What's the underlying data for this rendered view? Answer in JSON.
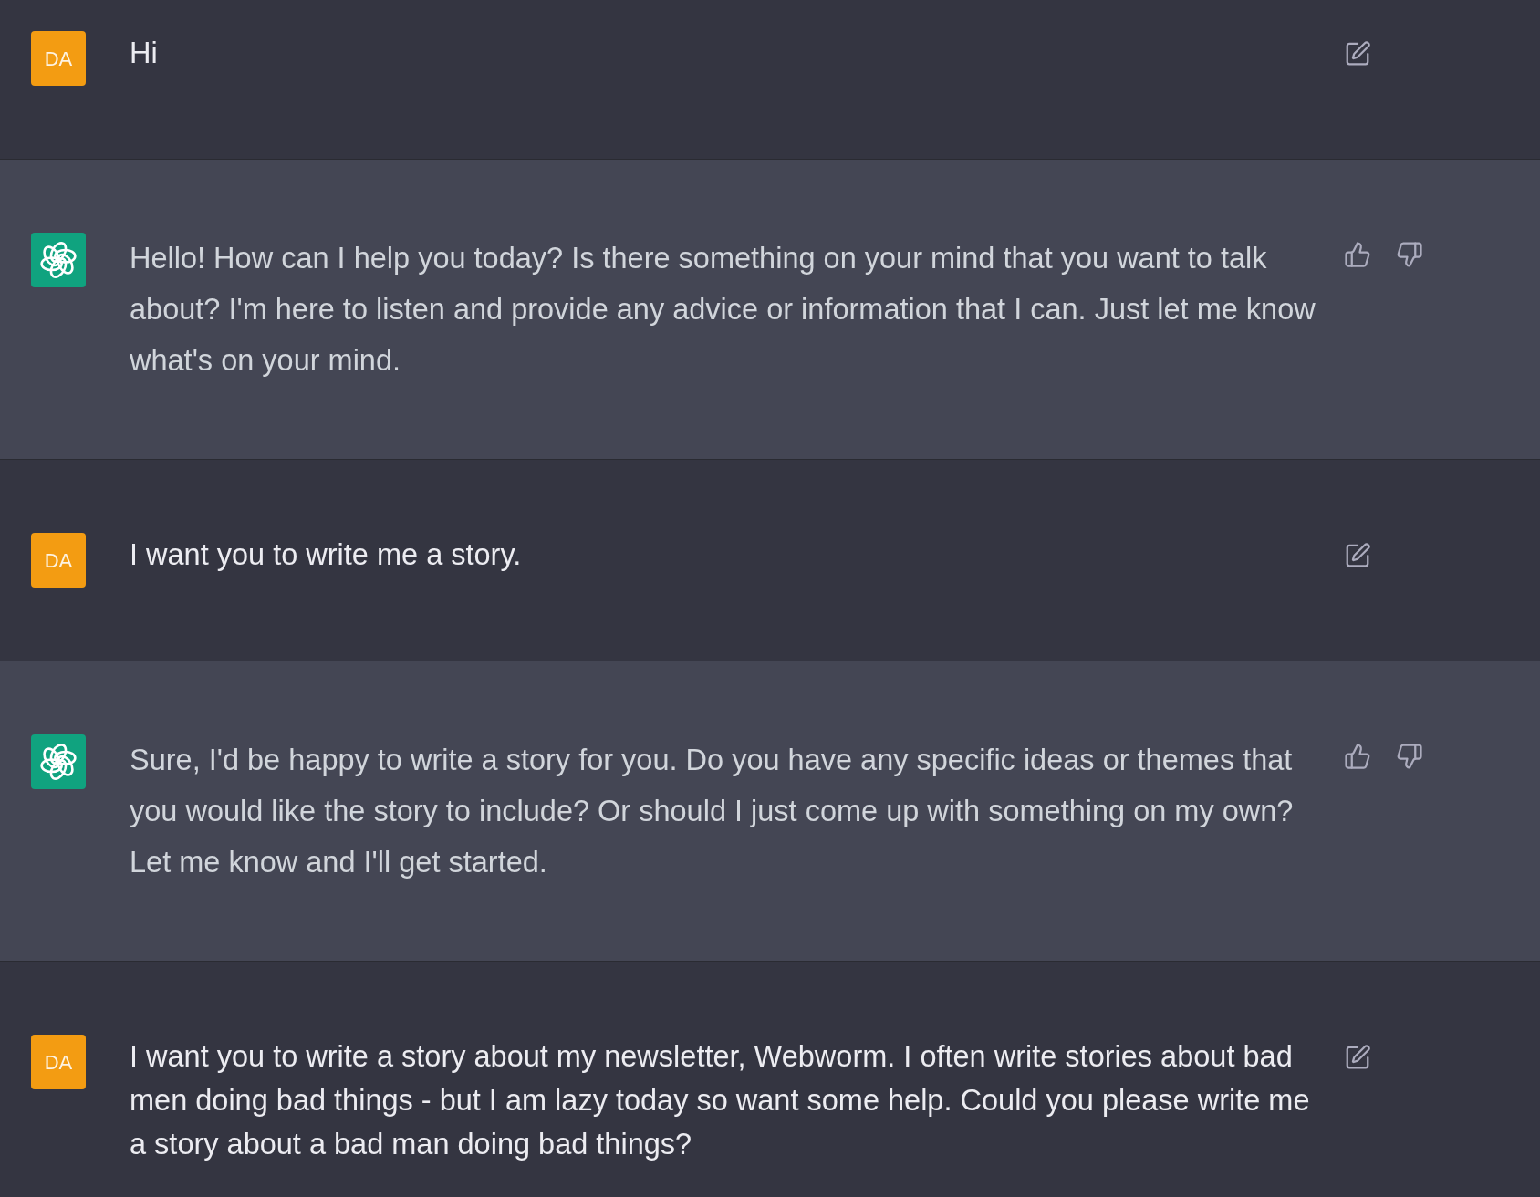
{
  "messages": [
    {
      "kind": "user",
      "avatar": "DA",
      "text": "Hi"
    },
    {
      "kind": "assistant",
      "text": "Hello! How can I help you today? Is there something on your mind that you want to talk about? I'm here to listen and provide any advice or information that I can. Just let me know what's on your mind."
    },
    {
      "kind": "user",
      "avatar": "DA",
      "text": "I want you to write me a story."
    },
    {
      "kind": "assistant",
      "text": "Sure, I'd be happy to write a story for you. Do you have any specific ideas or themes that you would like the story to include? Or should I just come up with something on my own? Let me know and I'll get started."
    },
    {
      "kind": "user",
      "avatar": "DA",
      "text": "I want you to write a story about my newsletter, Webworm. I often write stories about bad men doing bad things - but I am lazy today so want some help. Could you please write me a story about a bad man doing bad things?"
    }
  ]
}
